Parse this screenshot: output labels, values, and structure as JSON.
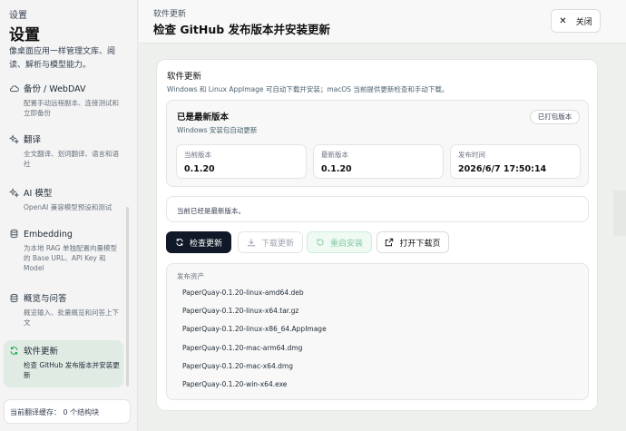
{
  "sidebar": {
    "breadcrumb": "设置",
    "title": "设置",
    "description": "像桌面应用一样管理文库、阅读、解析与模型能力。",
    "items": [
      {
        "label": "备份 / WebDAV",
        "sub": "配置手动远程副本、连接测试和立即备份",
        "icon": "cloud-icon"
      },
      {
        "label": "翻译",
        "sub": "全文翻译、划词翻译、语言和语社",
        "icon": "sparkles-icon"
      },
      {
        "label": "AI 模型",
        "sub": "OpenAI 兼容模型预设和测试",
        "icon": "sparkles-icon"
      },
      {
        "label": "Embedding",
        "sub": "为本地 RAG 单独配置向量模型的 Base URL、API Key 和 Model",
        "icon": "database-icon"
      },
      {
        "label": "概览与问答",
        "sub": "概览输入、批量概览和问答上下文",
        "icon": "database-icon"
      },
      {
        "label": "软件更新",
        "sub": "检查 GitHub 发布版本并安装更新",
        "icon": "refresh-icon"
      }
    ],
    "footer": "当前翻译缓存：  0 个结构块"
  },
  "header": {
    "breadcrumb": "软件更新",
    "title": "检查 GitHub 发布版本并安装更新",
    "close_label": "关闭"
  },
  "card": {
    "title": "软件更新",
    "description": "Windows 和 Linux AppImage 可自动下载并安装；macOS 当前提供更新检查和手动下载。",
    "status": {
      "title": "已是最新版本",
      "subtitle": "Windows 安装包自动更新",
      "badge": "已打包版本",
      "current_label": "当前版本",
      "current_value": "0.1.20",
      "latest_label": "最新版本",
      "latest_value": "0.1.20",
      "published_label": "发布时间",
      "published_value": "2026/6/7 17:50:14"
    },
    "message": "当前已经是最新版本。",
    "buttons": {
      "check": "检查更新",
      "download": "下载更新",
      "restart": "重启安装",
      "open_download": "打开下载页"
    },
    "assets": {
      "title": "发布资产",
      "files": [
        "PaperQuay-0.1.20-linux-amd64.deb",
        "PaperQuay-0.1.20-linux-x64.tar.gz",
        "PaperQuay-0.1.20-linux-x86_64.AppImage",
        "PaperQuay-0.1.20-mac-arm64.dmg",
        "PaperQuay-0.1.20-mac-x64.dmg",
        "PaperQuay-0.1.20-win-x64.exe"
      ]
    }
  }
}
